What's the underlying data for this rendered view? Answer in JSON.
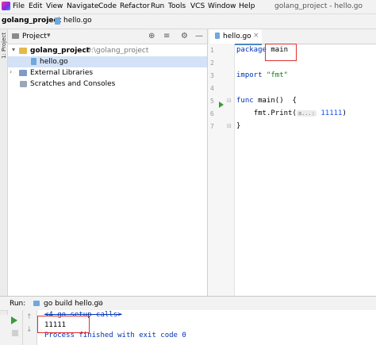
{
  "menubar": {
    "items": [
      "File",
      "Edit",
      "View",
      "Navigate",
      "Code",
      "Refactor",
      "Run",
      "Tools",
      "VCS",
      "Window",
      "Help"
    ],
    "title": "golang_project - hello.go"
  },
  "navbar": {
    "project": "golang_project",
    "separator": "›",
    "file": "hello.go"
  },
  "leftstripe": {
    "label": "1: Project"
  },
  "project_panel": {
    "header": "Project",
    "dropdown": "▾",
    "toolbar": [
      "⊕",
      "≡",
      "⚙",
      "—"
    ],
    "tree": {
      "root_name": "golang_project",
      "root_path": "D:\\golang_project",
      "file": "hello.go",
      "external_libraries": "External Libraries",
      "scratches": "Scratches and Consoles"
    }
  },
  "editor": {
    "tab": {
      "name": "hello.go",
      "close": "×"
    },
    "line_numbers": [
      "1",
      "2",
      "3",
      "4",
      "5",
      "6",
      "7"
    ],
    "code": {
      "l1_kw": "package",
      "l1_name": " main",
      "l3_kw": "import",
      "l3_str": " \"fmt\"",
      "l5_kw": "func",
      "l5_rest": " main()  {",
      "l6_indent": "    ",
      "l6_call": "fmt.Print(",
      "l6_hint": "a...:",
      "l6_num": " 11111",
      "l6_close": ")",
      "l7": "}"
    }
  },
  "run_panel": {
    "label": "Run:",
    "config": "go build hello.go",
    "close": "×",
    "nav_up": "↑",
    "nav_down": "↓",
    "console": {
      "setup": "<4 go setup calls>",
      "output": "11111",
      "finished": "Process finished with exit code 0"
    }
  }
}
